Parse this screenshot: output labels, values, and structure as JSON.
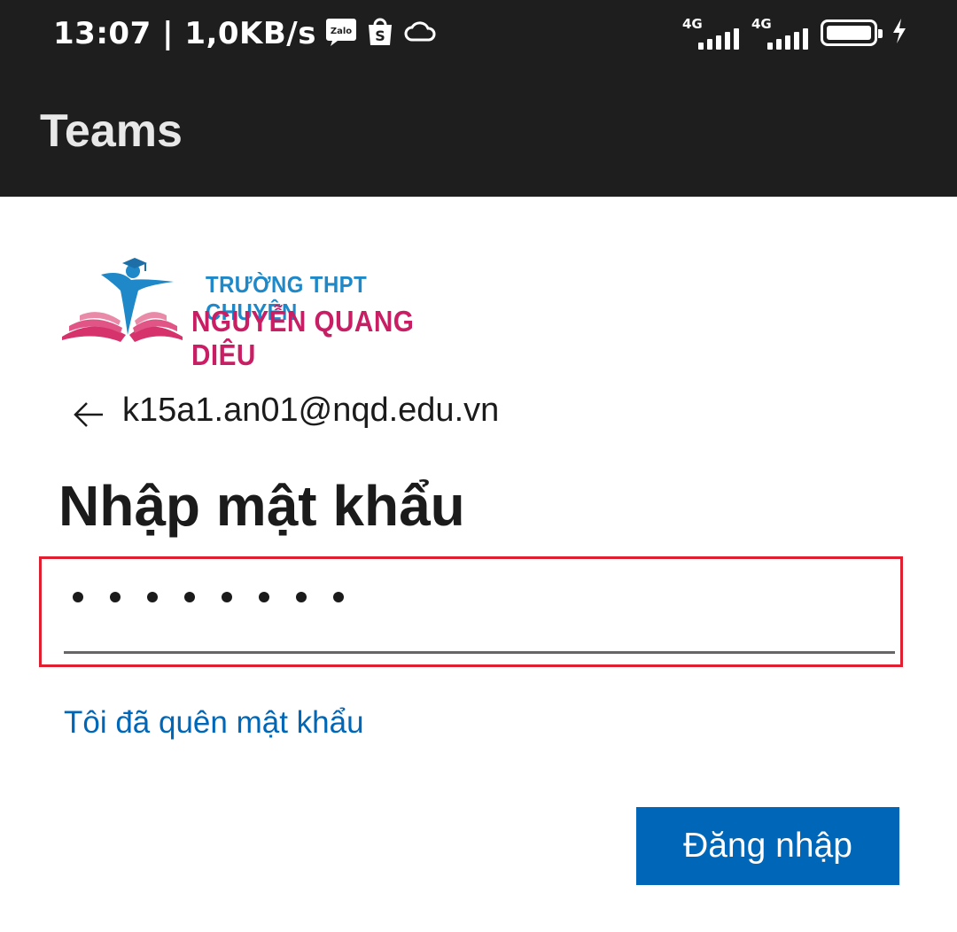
{
  "status_bar": {
    "time_speed": "13:07 | 1,0KB/s",
    "notification_icons": [
      "zalo-icon",
      "shopee-icon",
      "cloud-icon"
    ],
    "zalo_label": "Zalo",
    "shopee_label": "S",
    "network_1": "4G",
    "network_2": "4G"
  },
  "app_bar": {
    "title": "Teams"
  },
  "logo": {
    "line1": "TRƯỜNG THPT CHUYÊN",
    "line2": "NGUYỄN QUANG DIÊU"
  },
  "account": {
    "email": "k15a1.an01@nqd.edu.vn"
  },
  "page": {
    "heading": "Nhập mật khẩu",
    "password_mask": "••••••••",
    "password_length": 8,
    "forgot_link": "Tôi đã quên mật khẩu",
    "signin_button": "Đăng nhập"
  },
  "colors": {
    "bar_bg": "#1e1e1e",
    "primary": "#0067b8",
    "highlight": "#e02030",
    "logo_blue": "#1e88c8",
    "logo_pink": "#c81e64"
  }
}
